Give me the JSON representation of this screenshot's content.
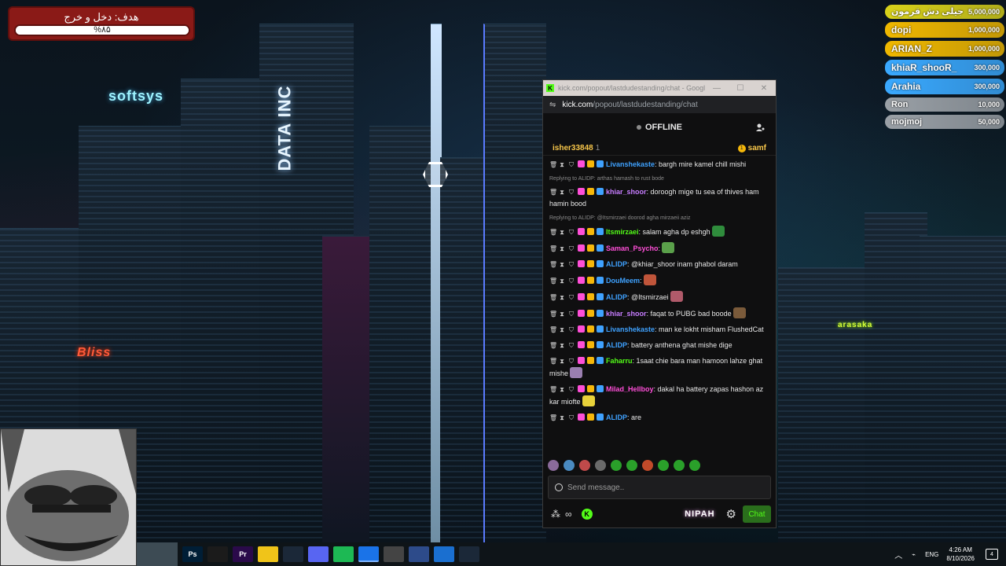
{
  "goal": {
    "title": "هدف: دخل و خرج",
    "percent_text": "%۸۵",
    "fill_fraction": 1.0
  },
  "leaderboard": [
    {
      "name": "جیلی دش قرمون",
      "amount": "5,000,000",
      "color": "#d9d21a"
    },
    {
      "name": "dopi",
      "amount": "1,000,000",
      "color": "#f0b800"
    },
    {
      "name": "ARIAN_Z",
      "amount": "1,000,000",
      "color": "#f0b800"
    },
    {
      "name": "khiaR_shooR_",
      "amount": "300,000",
      "color": "#3aa9ff"
    },
    {
      "name": "Arahia",
      "amount": "300,000",
      "color": "#3aa9ff"
    },
    {
      "name": "Ron",
      "amount": "10,000",
      "color": "#9aa0a6"
    },
    {
      "name": "mojmoj",
      "amount": "50,000",
      "color": "#9aa0a6"
    }
  ],
  "scene": {
    "signs": [
      "softsys",
      "DATA INC",
      "Bliss",
      "arasaka"
    ]
  },
  "window": {
    "title": "kick.com/popout/lastdudestanding/chat - Google C...",
    "url_domain": "kick.com",
    "url_path": "/popout/lastdudestanding/chat",
    "status": "OFFLINE",
    "pinned_user": "isher33848",
    "pinned_count": "1",
    "pinned_right_user": "samf"
  },
  "messages": [
    {
      "reply": "",
      "user": "Livanshekaste",
      "color": "#3fa2ff",
      "text": ": bargh mire kamel chill mishi",
      "emote": ""
    },
    {
      "reply": "Replying to ALIDP: arthas hamash to rust bode",
      "user": "",
      "color": "",
      "text": "",
      "emote": ""
    },
    {
      "reply": "",
      "user": "khiar_shoor",
      "color": "#c77dff",
      "text": ": doroogh mige tu sea of thives ham hamin bood",
      "emote": ""
    },
    {
      "reply": "Replying to ALIDP: @Itsmirzaei doorod agha mirzaeii aziz",
      "user": "",
      "color": "",
      "text": "",
      "emote": ""
    },
    {
      "reply": "",
      "user": "Itsmirzaei",
      "color": "#53fc18",
      "text": ": salam agha dp eshgh",
      "emote": "#2f8c3c"
    },
    {
      "reply": "",
      "user": "Saman_Psycho",
      "color": "#ff4fd8",
      "text": ":",
      "emote": "#5aa04a"
    },
    {
      "reply": "",
      "user": "ALIDP",
      "color": "#3fa2ff",
      "text": ": @khiar_shoor inam ghabol daram",
      "emote": ""
    },
    {
      "reply": "",
      "user": "DouMeem",
      "color": "#3fa2ff",
      "text": ":",
      "emote": "#c0553a"
    },
    {
      "reply": "",
      "user": "ALIDP",
      "color": "#3fa2ff",
      "text": ": @Itsmirzaei",
      "emote": "#b05a6a"
    },
    {
      "reply": "",
      "user": "khiar_shoor",
      "color": "#c77dff",
      "text": ": faqat to PUBG bad boode",
      "emote": "#7a5a3a"
    },
    {
      "reply": "",
      "user": "Livanshekaste",
      "color": "#3fa2ff",
      "text": ": man ke lokht misham FlushedCat",
      "emote": ""
    },
    {
      "reply": "",
      "user": "ALIDP",
      "color": "#3fa2ff",
      "text": ": battery anthena ghat mishe dige",
      "emote": ""
    },
    {
      "reply": "",
      "user": "Faharru",
      "color": "#53fc18",
      "text": ": 1saat chie bara man hamoon lahze ghat mishe",
      "emote": "#9a7fb0"
    },
    {
      "reply": "",
      "user": "Milad_Hellboy",
      "color": "#ff4fd8",
      "text": ": dakal ha battery zapas hashon az kar mioftе",
      "emote": "#e8d23a"
    },
    {
      "reply": "",
      "user": "ALIDP",
      "color": "#3fa2ff",
      "text": ": are",
      "emote": ""
    }
  ],
  "emote_bar_colors": [
    "#8a6a9a",
    "#4a8ac0",
    "#c04a4a",
    "#6a6a6a",
    "#2aa02a",
    "#2aa02a",
    "#c04a2a",
    "#2aa02a",
    "#2aa02a",
    "#2aa02a"
  ],
  "chat_input": {
    "placeholder": "Send message.."
  },
  "bottom": {
    "nipah": "NIPAH",
    "chat_button": "Chat",
    "infinity": "∞"
  },
  "taskbar": {
    "apps": [
      "Ps",
      "",
      "Pr",
      "",
      "",
      "",
      "",
      "",
      "",
      "",
      "",
      ""
    ],
    "lang": "ENG",
    "time": "4:26 AM",
    "date": "8/10/2026",
    "notif_count": "4"
  }
}
